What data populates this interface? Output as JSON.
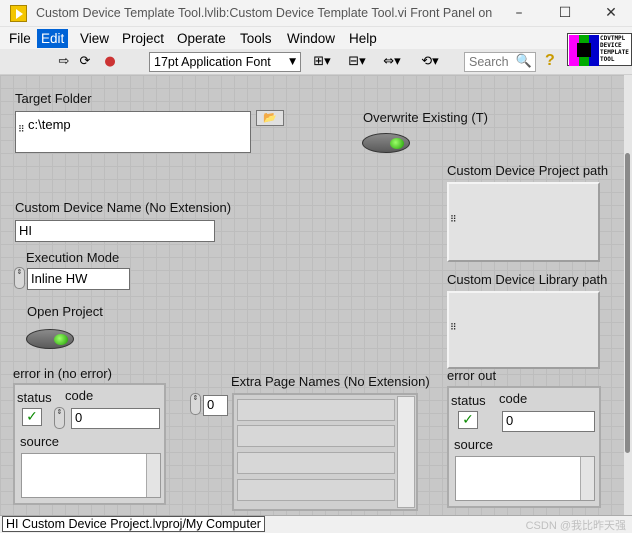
{
  "window": {
    "title": "Custom Device Template Tool.lvlib:Custom Device Template Tool.vi Front Panel on HI...",
    "minimize_icon": "–",
    "maximize_icon": "☐",
    "close_icon": "✕"
  },
  "menu": {
    "items": [
      "File",
      "Edit",
      "View",
      "Project",
      "Operate",
      "Tools",
      "Window",
      "Help"
    ],
    "active": "Edit"
  },
  "toolbar": {
    "run_icon": "⇨",
    "run_continuous_icon": "⟳",
    "abort_icon": "●",
    "font_select": "17pt Application Font",
    "dropdown_icon": "▼",
    "align_icon": "⊞▾",
    "distribute_icon": "⊟▾",
    "resize_icon": "⇔▾",
    "reorder_icon": "⟲▾",
    "search_placeholder": "Search",
    "search_icon": "🔍",
    "help_icon": "?",
    "vi_icon_text": "CDVTMPL DEVICE TEMPLATE TOOL"
  },
  "panel": {
    "target_folder": {
      "label": "Target Folder",
      "value": "c:\\temp",
      "browse_icon": "📂",
      "path_glyph": "⠿"
    },
    "overwrite_existing": {
      "label": "Overwrite Existing (T)"
    },
    "custom_device_name": {
      "label": "Custom Device Name (No Extension)",
      "value": "HI"
    },
    "execution_mode": {
      "label": "Execution Mode",
      "value": "Inline HW",
      "ring_icon": "⇕"
    },
    "open_project": {
      "label": "Open Project"
    },
    "project_path": {
      "label": "Custom Device Project path",
      "path_glyph": "⠿"
    },
    "library_path": {
      "label": "Custom Device Library path",
      "path_glyph": "⠿"
    },
    "error_in": {
      "label": "error in (no error)",
      "status_label": "status",
      "code_label": "code",
      "code_value": "0",
      "source_label": "source",
      "check_icon": "✓"
    },
    "extra_pages": {
      "label": "Extra Page Names (No Extension)",
      "index": "0"
    },
    "error_out": {
      "label": "error out",
      "status_label": "status",
      "code_label": "code",
      "code_value": "0",
      "source_label": "source",
      "check_icon": "✓"
    }
  },
  "statusbar": {
    "context": "HI Custom Device Project.lvproj/My Computer",
    "watermark": "CSDN @我比昨天强"
  }
}
